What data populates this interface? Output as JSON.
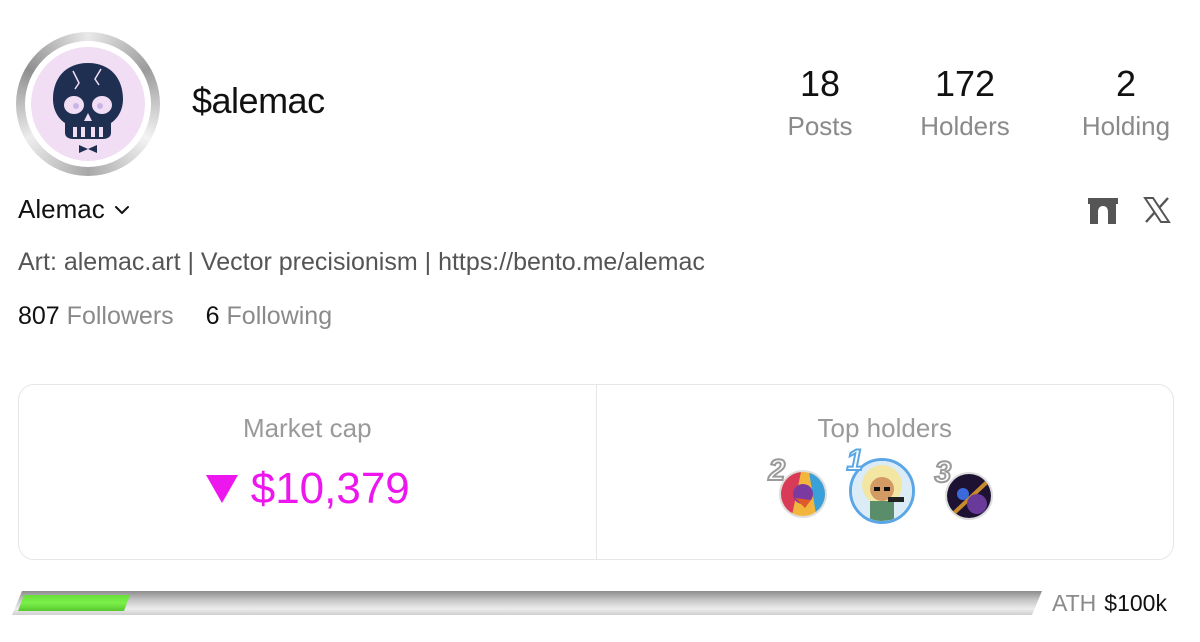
{
  "profile": {
    "handle": "$alemac",
    "display_name": "Alemac",
    "bio": "Art: alemac.art | Vector precisionism | https://bento.me/alemac",
    "avatar_icon": "skull-avatar-icon"
  },
  "stats": {
    "posts": {
      "value": "18",
      "label": "Posts"
    },
    "holders": {
      "value": "172",
      "label": "Holders"
    },
    "holding": {
      "value": "2",
      "label": "Holding"
    }
  },
  "follow": {
    "followers_count": "807",
    "followers_label": "Followers",
    "following_count": "6",
    "following_label": "Following"
  },
  "socials": [
    {
      "name": "arch-icon"
    },
    {
      "name": "x-icon"
    }
  ],
  "market": {
    "label": "Market cap",
    "value": "$10,379",
    "trend": "down",
    "color": "#ee16ee"
  },
  "top_holders": {
    "label": "Top holders",
    "ranks": [
      "1",
      "2",
      "3"
    ]
  },
  "progress": {
    "fraction": 0.11,
    "ath_label": "ATH",
    "ath_value": "$100k",
    "fill_color": "#6fe63e"
  }
}
